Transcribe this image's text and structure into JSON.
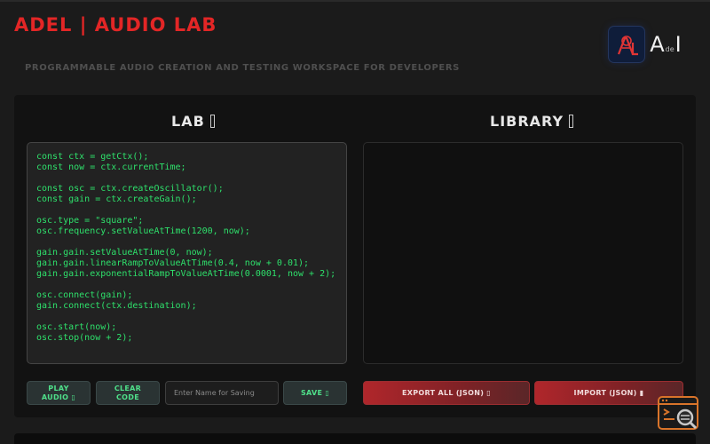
{
  "app": {
    "title": "ADEL | AUDIO LAB",
    "subtitle": "PROGRAMMABLE AUDIO CREATION AND TESTING WORKSPACE FOR DEVELOPERS"
  },
  "logos": {
    "left": "AL",
    "right_big_a": "A",
    "right_small": "de",
    "right_big_i": "I"
  },
  "lab": {
    "title": "LAB",
    "code": [
      "const ctx = getCtx();",
      "const now = ctx.currentTime;",
      "",
      "const osc = ctx.createOscillator();",
      "const gain = ctx.createGain();",
      "",
      "osc.type = \"square\";",
      "osc.frequency.setValueAtTime(1200, now);",
      "",
      "gain.gain.setValueAtTime(0, now);",
      "gain.gain.linearRampToValueAtTime(0.4, now + 0.01);",
      "gain.gain.exponentialRampToValueAtTime(0.0001, now + 2);",
      "",
      "osc.connect(gain);",
      "gain.connect(ctx.destination);",
      "",
      "osc.start(now);",
      "osc.stop(now + 2);"
    ],
    "buttons": {
      "play_line1": "PLAY",
      "play_line2": "AUDIO ▯",
      "clear_line1": "CLEAR",
      "clear_line2": "CODE",
      "save": "SAVE ▯"
    },
    "name_input": {
      "placeholder": "Enter Name for Saving",
      "value": ""
    }
  },
  "library": {
    "title": "LIBRARY",
    "buttons": {
      "export": "EXPORT ALL (JSON) ▯",
      "import": "IMPORT (JSON) ▮"
    }
  },
  "colors": {
    "brand": "#e32626",
    "code_text": "#2ee06b",
    "button_text": "#4fe08a",
    "accent_red": "#b0262b"
  },
  "icons": {
    "corner": "terminal-search-icon"
  }
}
